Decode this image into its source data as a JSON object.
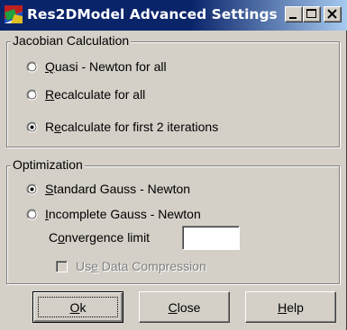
{
  "window": {
    "title": "Res2DModel Advanced Settings",
    "icon": "res2dmodel-app-icon",
    "controls": [
      "minimize-icon",
      "maximize-icon",
      "close-icon"
    ]
  },
  "jacobian": {
    "legend": "Jacobian Calculation",
    "options": [
      {
        "pre": "",
        "key": "Q",
        "post": "uasi - Newton for all",
        "selected": false
      },
      {
        "pre": "",
        "key": "R",
        "post": "ecalculate for all",
        "selected": false
      },
      {
        "pre": "R",
        "key": "e",
        "post": "calculate for first 2 iterations",
        "selected": true
      }
    ]
  },
  "optimization": {
    "legend": "Optimization",
    "options": [
      {
        "pre": "",
        "key": "S",
        "post": "tandard Gauss - Newton",
        "selected": true
      },
      {
        "pre": "",
        "key": "I",
        "post": "ncomplete Gauss - Newton",
        "selected": false
      }
    ],
    "convergence": {
      "pre": "C",
      "key": "o",
      "post": "nvergence limit",
      "value": ""
    },
    "compression": {
      "pre": "Us",
      "key": "e",
      "post": " Data Compression",
      "checked": false,
      "enabled": false
    }
  },
  "buttons": {
    "ok": {
      "pre": "",
      "key": "O",
      "post": "k"
    },
    "close": {
      "pre": "",
      "key": "C",
      "post": "lose"
    },
    "help": {
      "pre": "",
      "key": "H",
      "post": "elp"
    }
  }
}
